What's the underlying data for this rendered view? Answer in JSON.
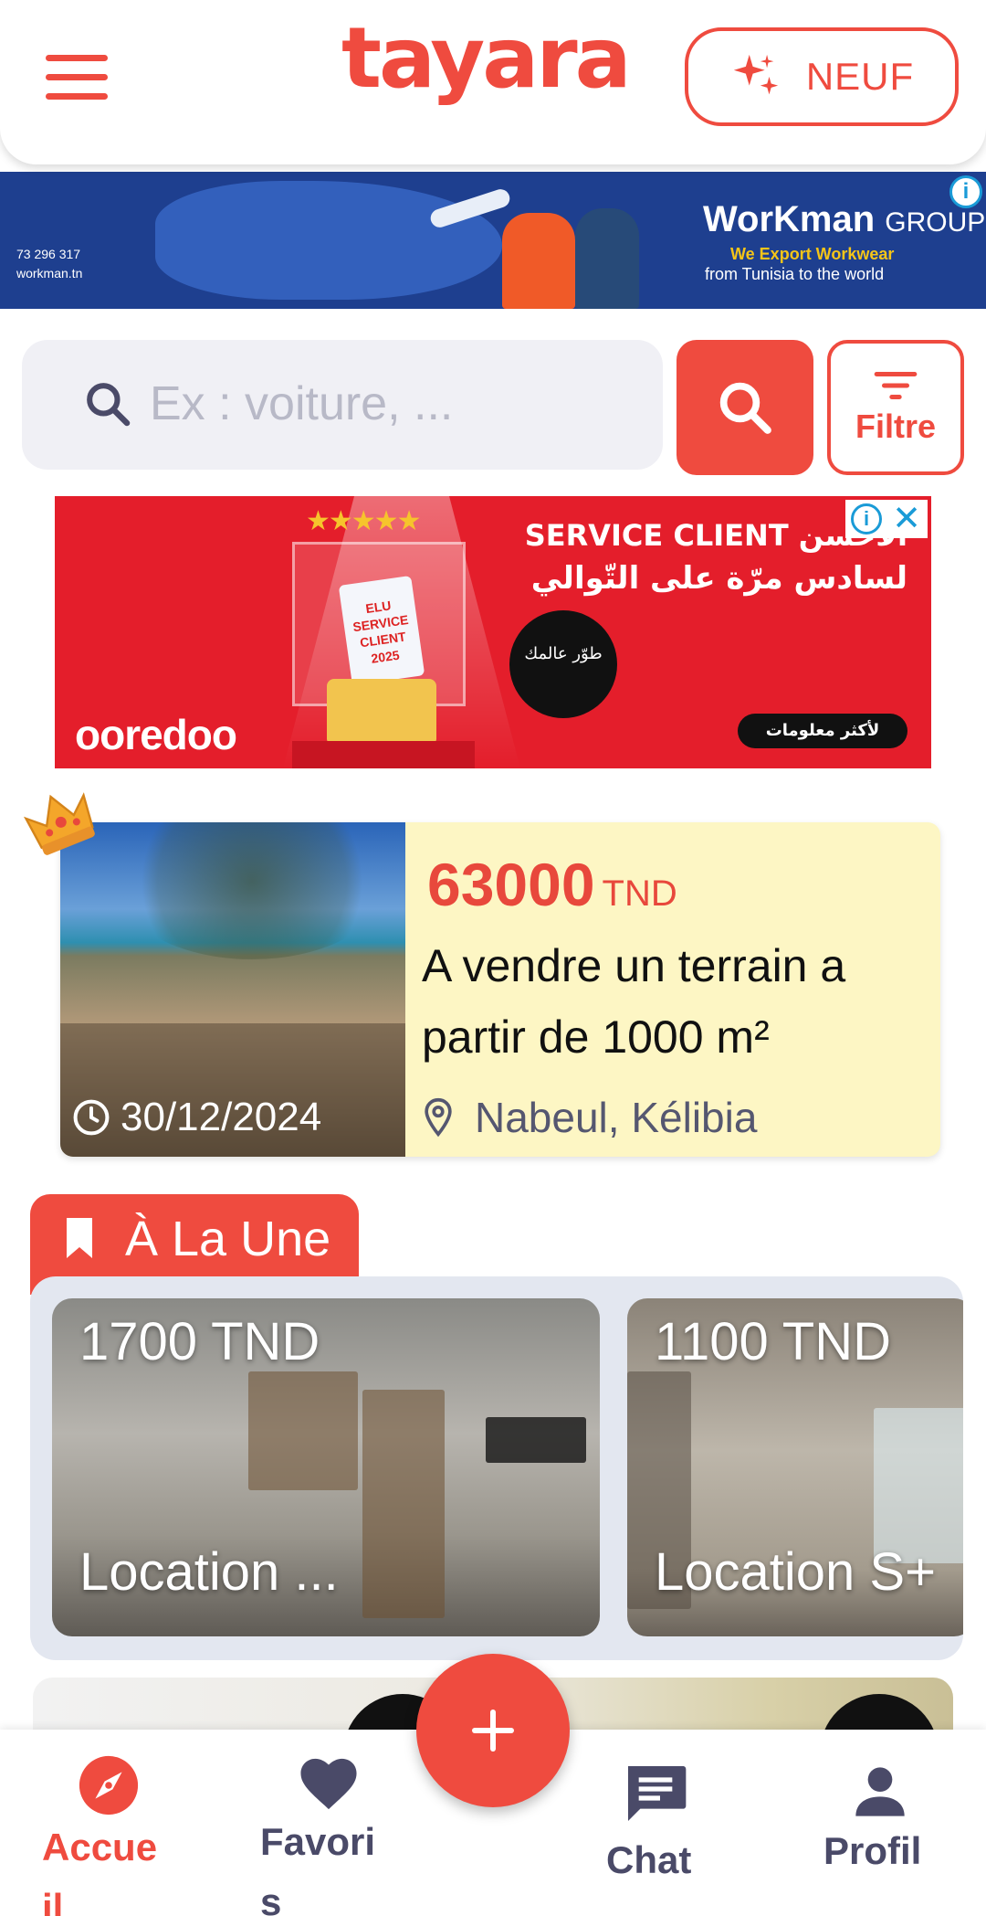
{
  "header": {
    "logo": "tayara",
    "neuf_label": "NEUF",
    "accent": "#ef4b3f"
  },
  "ad_top": {
    "brand": "WorKman",
    "brand_suffix": "GROUP",
    "tagline_1": "We Export Workwear",
    "tagline_2": "from Tunisia to the world",
    "phone": "73 296 317",
    "site": "workman.tn",
    "info_icon": "info-icon"
  },
  "search": {
    "placeholder": "Ex : voiture, ...",
    "filter_label": "Filtre"
  },
  "ad_mid": {
    "brand": "ooredoo",
    "headline_1": "SERVICE CLIENT الأحسن",
    "headline_2": "لسادس مرّة على التّوالي",
    "circle_text": "طوّر عالمك",
    "cta": "لأكثر معلومات",
    "badge": "ELU SERVICE CLIENT 2025"
  },
  "premium": {
    "price": "63000",
    "currency": "TND",
    "title": "A vendre un terrain a partir de 1000 m²",
    "date": "30/12/2024",
    "location": "Nabeul, Kélibia",
    "background": "#fdf6c4"
  },
  "une": {
    "tab_label": "À La Une",
    "cards": [
      {
        "price": "1700 TND",
        "title": "Location ..."
      },
      {
        "price": "1100 TND",
        "title": "Location S+"
      }
    ]
  },
  "nav": {
    "items": [
      {
        "label": "Accue\nil",
        "icon": "compass-icon",
        "active": true
      },
      {
        "label": "Favori\ns",
        "icon": "heart-icon",
        "active": false
      },
      {
        "label": "Chat",
        "icon": "chat-icon",
        "active": false
      },
      {
        "label": "Profil",
        "icon": "profile-icon",
        "active": false
      }
    ],
    "fab_icon": "plus-icon",
    "active_color": "#ef4b3f",
    "inactive_color": "#4a4a68"
  }
}
